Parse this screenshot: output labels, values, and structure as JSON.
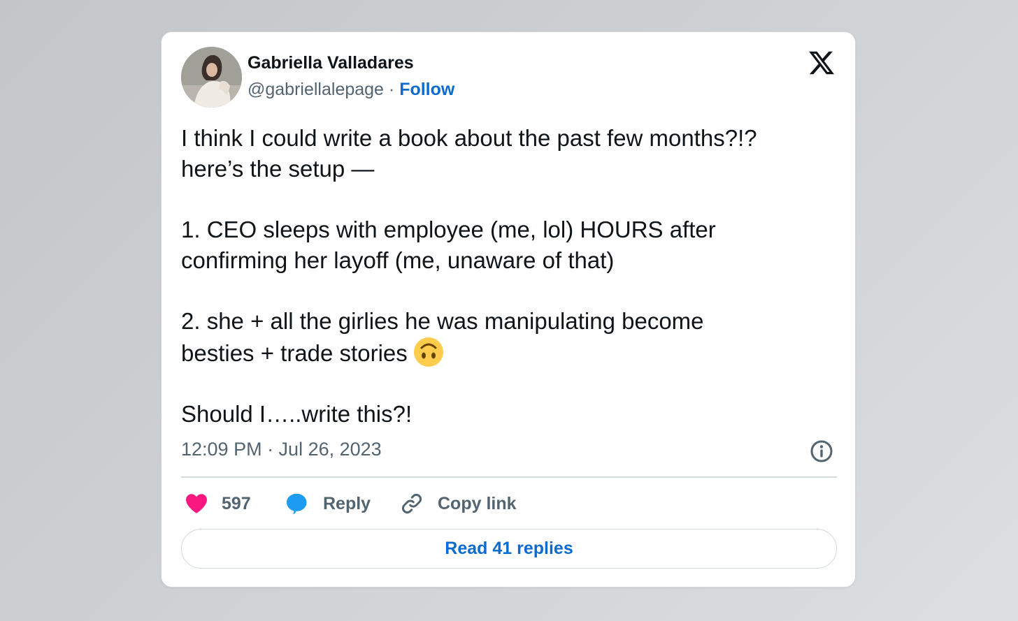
{
  "author": {
    "display_name": "Gabriella Valladares",
    "handle": "@gabriellalepage",
    "separator": " · ",
    "follow_label": "Follow"
  },
  "tweet": {
    "lines": [
      "I think I could write a book about the past few months?!?",
      "here’s the setup —",
      "1. CEO sleeps with employee (me, lol) HOURS after",
      "confirming her layoff (me, unaware of that)",
      "2. she + all the girlies he was manipulating become",
      "besties + trade stories",
      "Should I…..write this?!"
    ],
    "emoji": "upside-down-face-emoji",
    "timestamp": "12:09 PM · Jul 26, 2023"
  },
  "actions": {
    "like_count": "597",
    "reply_label": "Reply",
    "copy_link_label": "Copy link",
    "read_replies_label": "Read 41 replies"
  },
  "icons": {
    "brand": "x-logo-icon",
    "info": "info-icon",
    "like": "heart-icon",
    "reply": "speech-bubble-icon",
    "copy": "link-icon"
  },
  "colors": {
    "like_pink": "#f91880",
    "reply_blue": "#1d9bf0",
    "link_blue": "#0b6bd0",
    "secondary_text": "#536471",
    "primary_text": "#0f1419"
  }
}
